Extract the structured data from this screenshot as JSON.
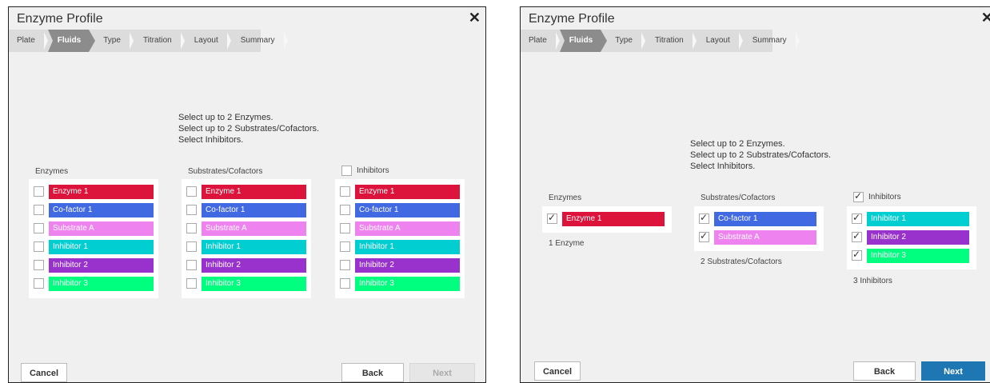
{
  "dialog_title": "Enzyme Profile",
  "close_glyph": "✕",
  "steps": [
    "Plate",
    "Fluids",
    "Type",
    "Titration",
    "Layout",
    "Summary"
  ],
  "active_step": "Fluids",
  "instructions": [
    "Select up to 2 Enzymes.",
    "Select up to 2 Substrates/Cofactors.",
    "Select Inhibitors."
  ],
  "columns": {
    "enzymes": "Enzymes",
    "substrates": "Substrates/Cofactors",
    "inhibitors": "Inhibitors"
  },
  "fluid_colors": {
    "Enzyme 1": "#dc143c",
    "Co-factor 1": "#4169e1",
    "Substrate A": "#ee82ee",
    "Inhibitor 1": "#00ced1",
    "Inhibitor 2": "#9932cc",
    "Inhibitor 3": "#00ff7f"
  },
  "left": {
    "all_fluids": [
      "Enzyme 1",
      "Co-factor 1",
      "Substrate A",
      "Inhibitor 1",
      "Inhibitor 2",
      "Inhibitor 3"
    ],
    "inhibitors_checked": false,
    "buttons": {
      "cancel": "Cancel",
      "back": "Back",
      "next": "Next"
    },
    "next_enabled": false
  },
  "right": {
    "enzymes": [
      "Enzyme 1"
    ],
    "substrates": [
      "Co-factor 1",
      "Substrate A"
    ],
    "inhibitors": [
      "Inhibitor 1",
      "Inhibitor 2",
      "Inhibitor 3"
    ],
    "inhibitors_checked": true,
    "counts": {
      "enzymes": "1 Enzyme",
      "substrates": "2 Substrates/Cofactors",
      "inhibitors": "3 Inhibitors"
    },
    "buttons": {
      "cancel": "Cancel",
      "back": "Back",
      "next": "Next"
    },
    "next_enabled": true
  }
}
